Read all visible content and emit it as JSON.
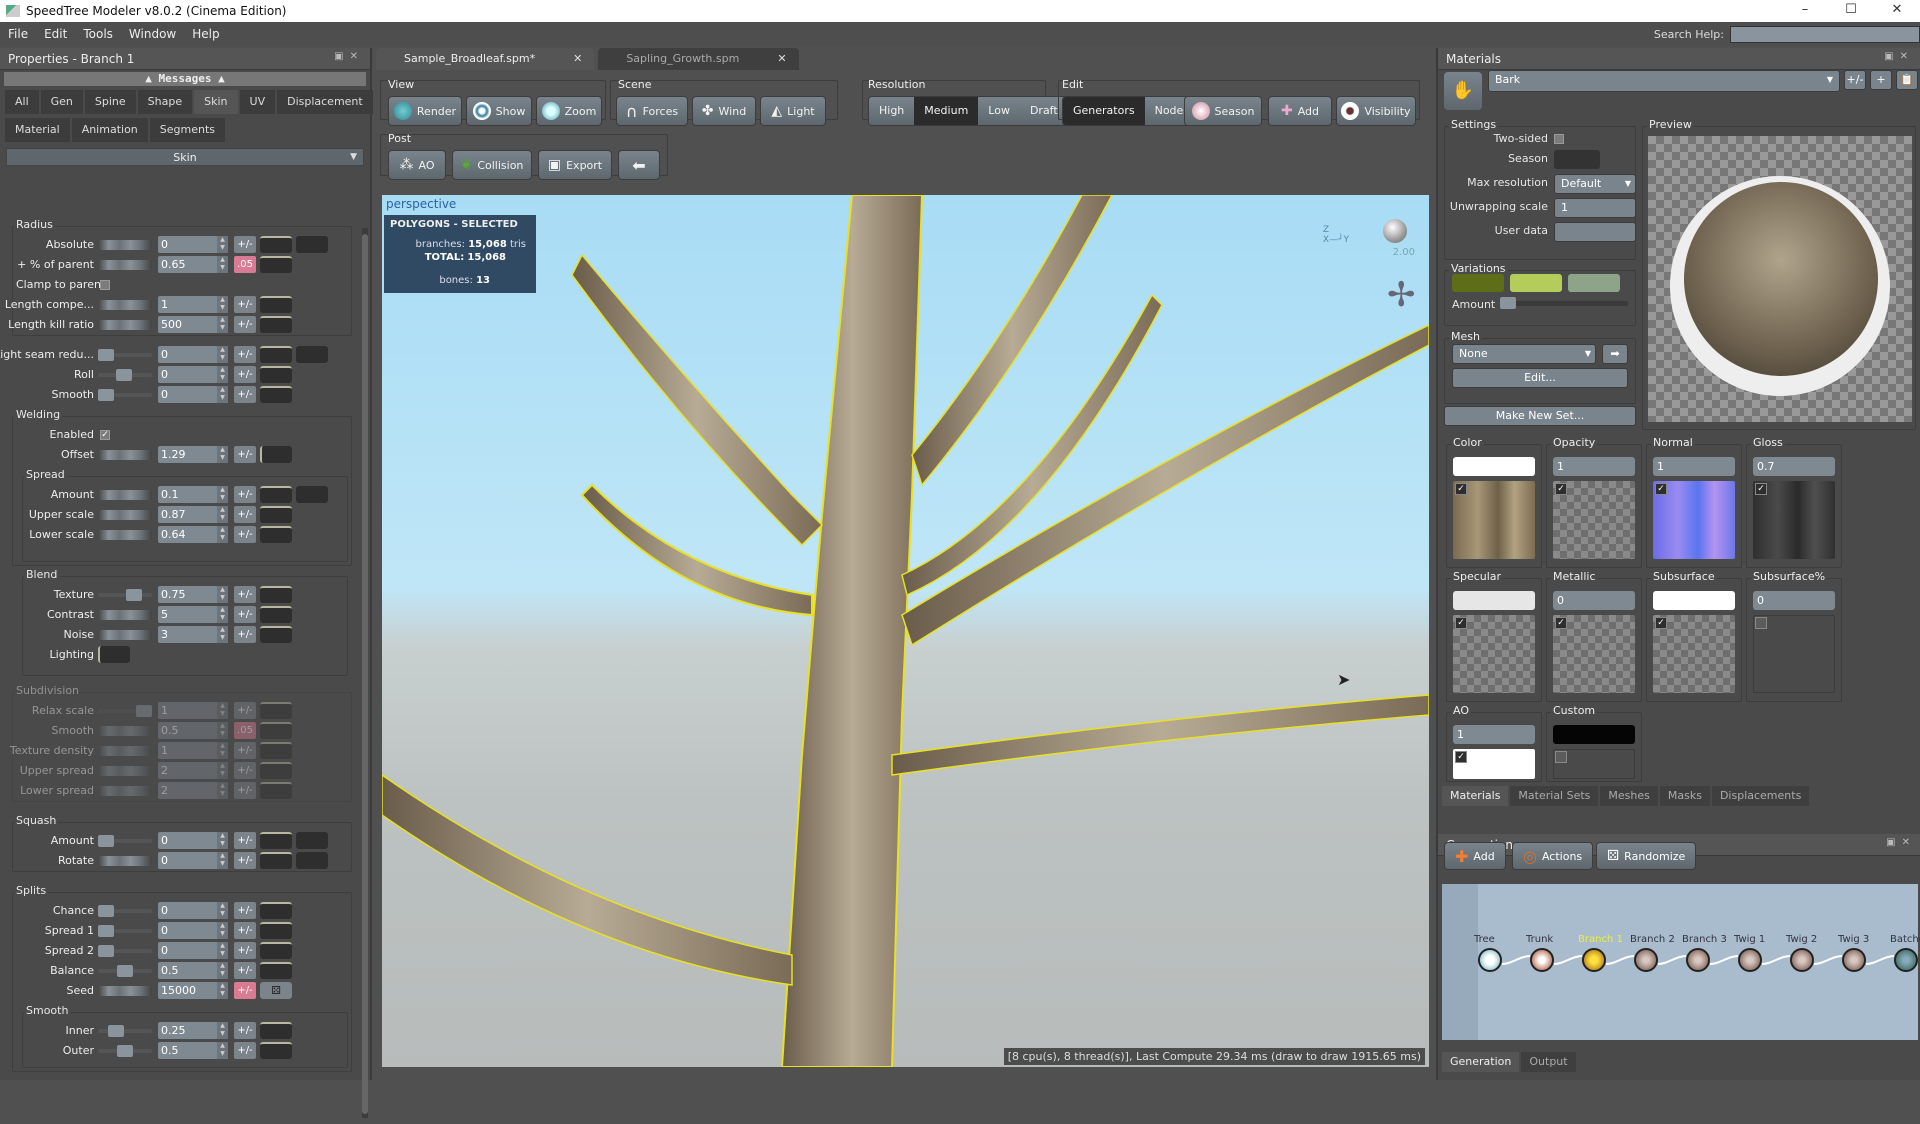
{
  "window": {
    "title": "SpeedTree Modeler v8.0.2 (Cinema Edition)",
    "minimize": "–",
    "maximize": "☐",
    "close": "✕"
  },
  "menu": [
    "File",
    "Edit",
    "Tools",
    "Window",
    "Help"
  ],
  "search_help": {
    "label": "Search Help:",
    "value": ""
  },
  "left_panel": {
    "title": "Properties - Branch 1",
    "messages": "Messages",
    "tabs_row1": [
      "All",
      "Gen",
      "Spine",
      "Shape",
      "Skin",
      "UV",
      "Displacement"
    ],
    "tabs_row2": [
      "Material",
      "Animation",
      "Segments"
    ],
    "active_tab": "Skin",
    "section_dropdown": "Skin",
    "groups": {
      "radius": "Radius",
      "welding": "Welding",
      "spread": "Spread",
      "blend": "Blend",
      "subdivision": "Subdivision",
      "squash": "Squash",
      "splits": "Splits",
      "smooth": "Smooth"
    },
    "props": {
      "absolute": {
        "label": "Absolute",
        "value": "0",
        "pm": "+/-"
      },
      "pct_parent": {
        "label": "+ % of parent",
        "value": "0.65",
        "pm": ".05"
      },
      "clamp": {
        "label": "Clamp to parent",
        "checked": false
      },
      "length_comp": {
        "label": "Length compe...",
        "value": "1",
        "pm": "+/-"
      },
      "length_kill": {
        "label": "Length kill ratio",
        "value": "500",
        "pm": "+/-"
      },
      "light_seam": {
        "label": "Light seam redu...",
        "value": "0",
        "pm": "+/-"
      },
      "roll": {
        "label": "Roll",
        "value": "0",
        "pm": "+/-"
      },
      "smooth": {
        "label": "Smooth",
        "value": "0",
        "pm": "+/-"
      },
      "enabled": {
        "label": "Enabled",
        "checked": true
      },
      "offset": {
        "label": "Offset",
        "value": "1.29",
        "pm": "+/-"
      },
      "spread_amount": {
        "label": "Amount",
        "value": "0.1",
        "pm": "+/-"
      },
      "upper_scale": {
        "label": "Upper scale",
        "value": "0.87",
        "pm": "+/-"
      },
      "lower_scale": {
        "label": "Lower scale",
        "value": "0.64",
        "pm": "+/-"
      },
      "texture": {
        "label": "Texture",
        "value": "0.75",
        "pm": "+/-"
      },
      "contrast": {
        "label": "Contrast",
        "value": "5",
        "pm": "+/-"
      },
      "noise": {
        "label": "Noise",
        "value": "3",
        "pm": "+/-"
      },
      "lighting": {
        "label": "Lighting"
      },
      "relax_scale": {
        "label": "Relax scale",
        "value": "1",
        "pm": "+/-"
      },
      "sub_smooth": {
        "label": "Smooth",
        "value": "0.5",
        "pm": ".05"
      },
      "texture_density": {
        "label": "Texture density",
        "value": "1",
        "pm": "+/-"
      },
      "upper_spread": {
        "label": "Upper spread",
        "value": "2",
        "pm": "+/-"
      },
      "lower_spread": {
        "label": "Lower spread",
        "value": "2",
        "pm": "+/-"
      },
      "squash_amount": {
        "label": "Amount",
        "value": "0",
        "pm": "+/-"
      },
      "rotate": {
        "label": "Rotate",
        "value": "0",
        "pm": "+/-"
      },
      "chance": {
        "label": "Chance",
        "value": "0",
        "pm": "+/-"
      },
      "spread1": {
        "label": "Spread 1",
        "value": "0",
        "pm": "+/-"
      },
      "spread2": {
        "label": "Spread 2",
        "value": "0",
        "pm": "+/-"
      },
      "balance": {
        "label": "Balance",
        "value": "0.5",
        "pm": "+/-"
      },
      "seed": {
        "label": "Seed",
        "value": "15000",
        "pm": "+/-"
      },
      "inner": {
        "label": "Inner",
        "value": "0.25",
        "pm": "+/-"
      },
      "outer": {
        "label": "Outer",
        "value": "0.5",
        "pm": "+/-"
      }
    }
  },
  "doc_tabs": [
    {
      "label": "Sample_Broadleaf.spm*",
      "active": true
    },
    {
      "label": "Sapling_Growth.spm",
      "active": false
    }
  ],
  "toolbar": {
    "view": {
      "label": "View",
      "buttons": [
        "Render",
        "Show",
        "Zoom"
      ]
    },
    "scene": {
      "label": "Scene",
      "buttons": [
        "Forces",
        "Wind",
        "Light"
      ]
    },
    "resolution": {
      "label": "Resolution",
      "options": [
        "High",
        "Medium",
        "Low",
        "Draft"
      ],
      "selected": "Medium"
    },
    "edit": {
      "label": "Edit",
      "modes": [
        "Generators",
        "Nodes"
      ],
      "selected": "Generators",
      "buttons": [
        "Season",
        "Add",
        "Visibility"
      ]
    },
    "post": {
      "label": "Post",
      "buttons": [
        "AO",
        "Collision",
        "Export"
      ]
    }
  },
  "viewport": {
    "camera": "perspective",
    "poly_title": "POLYGONS - SELECTED",
    "branches_label": "branches:",
    "branches_value": "15,068",
    "tris": "tris",
    "total_label": "TOTAL:",
    "total_value": "15,068",
    "bones_label": "bones:",
    "bones_value": "13",
    "light_intensity": "2.00",
    "axis": {
      "x": "X",
      "y": "Y",
      "z": "Z"
    },
    "status": "[8 cpu(s), 8 thread(s)], Last Compute 29.34 ms (draw to draw 1915.65 ms)"
  },
  "materials_panel": {
    "title": "Materials",
    "selected_material": "Bark",
    "pm": "+/-",
    "add": "+",
    "settings_label": "Settings",
    "two_sided": {
      "label": "Two-sided",
      "checked": false
    },
    "season_label": "Season",
    "max_resolution": {
      "label": "Max resolution",
      "value": "Default"
    },
    "unwrapping_scale": {
      "label": "Unwrapping scale",
      "value": "1"
    },
    "user_data": {
      "label": "User data",
      "value": ""
    },
    "preview_label": "Preview",
    "variations_label": "Variations",
    "variation_colors": [
      "#5e6e18",
      "#b4cc5a",
      "#8ea488"
    ],
    "amount_label": "Amount",
    "mesh_label": "Mesh",
    "mesh_value": "None",
    "edit_button": "Edit...",
    "make_new_set": "Make New Set...",
    "slots": [
      {
        "label": "Color",
        "value": "",
        "swatch": "white",
        "checked": true,
        "tex": "bark"
      },
      {
        "label": "Opacity",
        "value": "1",
        "checked": true,
        "tex": "checker"
      },
      {
        "label": "Normal",
        "value": "1",
        "checked": true,
        "tex": "normal"
      },
      {
        "label": "Gloss",
        "value": "0.7",
        "checked": true,
        "tex": "gloss"
      },
      {
        "label": "Specular",
        "value": "",
        "swatch": "lgray",
        "checked": true,
        "tex": "checker"
      },
      {
        "label": "Metallic",
        "value": "0",
        "checked": true,
        "tex": "checker"
      },
      {
        "label": "Subsurface",
        "value": "",
        "swatch": "white",
        "checked": true,
        "tex": "checker"
      },
      {
        "label": "Subsurface%",
        "value": "0",
        "checked": false,
        "tex": "empty"
      },
      {
        "label": "AO",
        "value": "1",
        "checked": true,
        "tex": "whitebox"
      },
      {
        "label": "Custom",
        "value": "",
        "swatch": "black",
        "checked": false,
        "tex": "empty"
      }
    ],
    "bottom_tabs": [
      "Materials",
      "Material Sets",
      "Meshes",
      "Masks",
      "Displacements"
    ],
    "active_bottom_tab": "Materials"
  },
  "generation_panel": {
    "title": "Generation",
    "buttons": [
      "Add",
      "Actions",
      "Randomize"
    ],
    "nodes": [
      "Tree",
      "Trunk",
      "Branch 1",
      "Branch 2",
      "Branch 3",
      "Twig 1",
      "Twig 2",
      "Twig 3",
      "BatchedLea"
    ],
    "selected_node": "Branch 1",
    "bottom_tabs": [
      "Generation",
      "Output"
    ],
    "active_bottom_tab": "Generation"
  }
}
